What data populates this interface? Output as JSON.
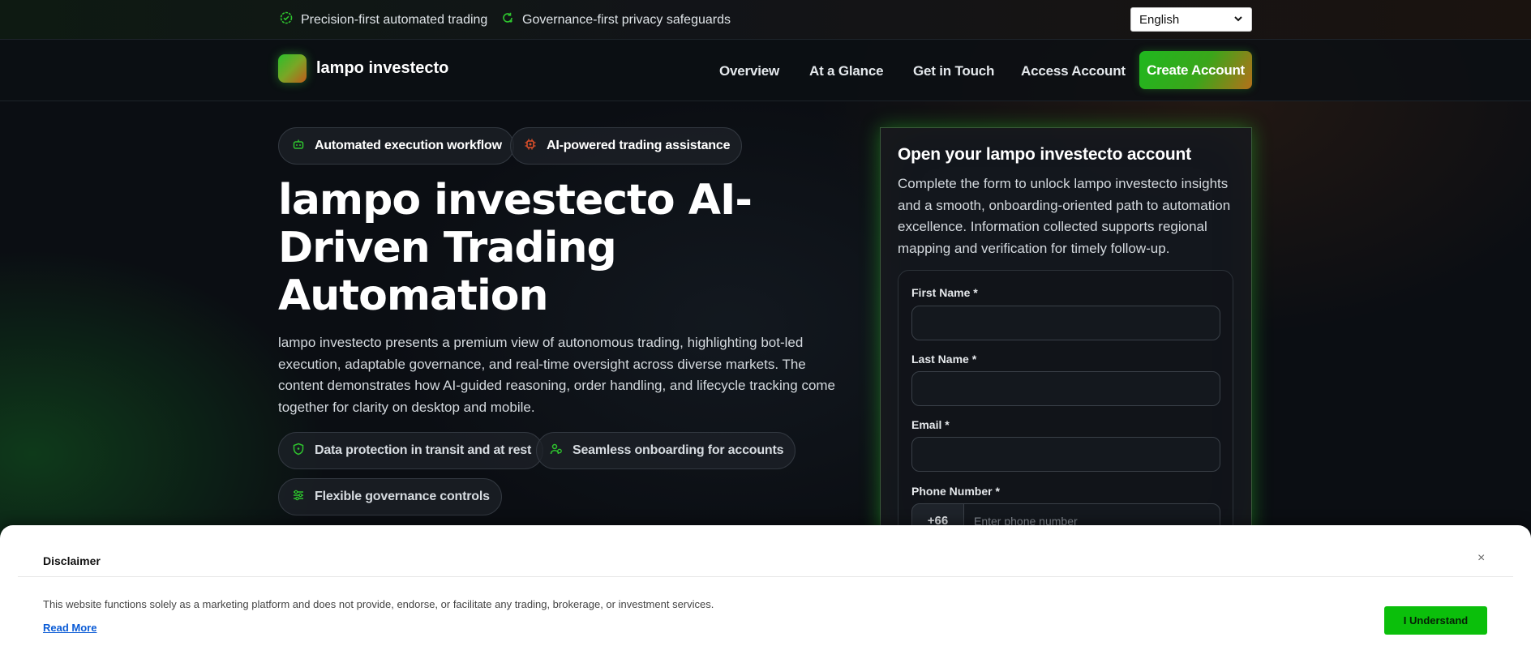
{
  "topbar": {
    "items": [
      {
        "icon": "badge-check-icon",
        "label": "Precision-first automated trading"
      },
      {
        "icon": "refresh-shield-icon",
        "label": "Governance-first privacy safeguards"
      }
    ],
    "language": "English"
  },
  "nav": {
    "brand": "lampo investecto",
    "links": [
      "Overview",
      "At a Glance",
      "Get in Touch",
      "Access Account"
    ],
    "cta": "Create Account"
  },
  "hero": {
    "tags": [
      "Automated execution workflow",
      "AI-powered trading assistance"
    ],
    "title": "lampo investecto AI-Driven Trading Automation",
    "description": "lampo investecto presents a premium view of autonomous trading, highlighting bot-led execution, adaptable governance, and real-time oversight across diverse markets. The content demonstrates how AI-guided reasoning, order handling, and lifecycle tracking come together for clarity on desktop and mobile.",
    "features": [
      "Data protection in transit and at rest",
      "Seamless onboarding for accounts",
      "Flexible governance controls"
    ]
  },
  "form": {
    "title": "Open your lampo investecto account",
    "description": "Complete the form to unlock lampo investecto insights and a smooth, onboarding-oriented path to automation excellence. Information collected supports regional mapping and verification for timely follow-up.",
    "first_name_label": "First Name *",
    "last_name_label": "Last Name *",
    "email_label": "Email *",
    "phone_label": "Phone Number *",
    "phone_prefix": "+66",
    "phone_placeholder": "Enter phone number"
  },
  "disclaimer": {
    "title": "Disclaimer",
    "close": "×",
    "text": "This website functions solely as a marketing platform and does not provide, endorse, or facilitate any trading, brokerage, or investment services.",
    "read_more": "Read More",
    "button": "I Understand"
  },
  "colors": {
    "accent_green": "#1fb81f",
    "accent_orange": "#c05a1a",
    "tag_icon_orange": "#e0502a"
  }
}
